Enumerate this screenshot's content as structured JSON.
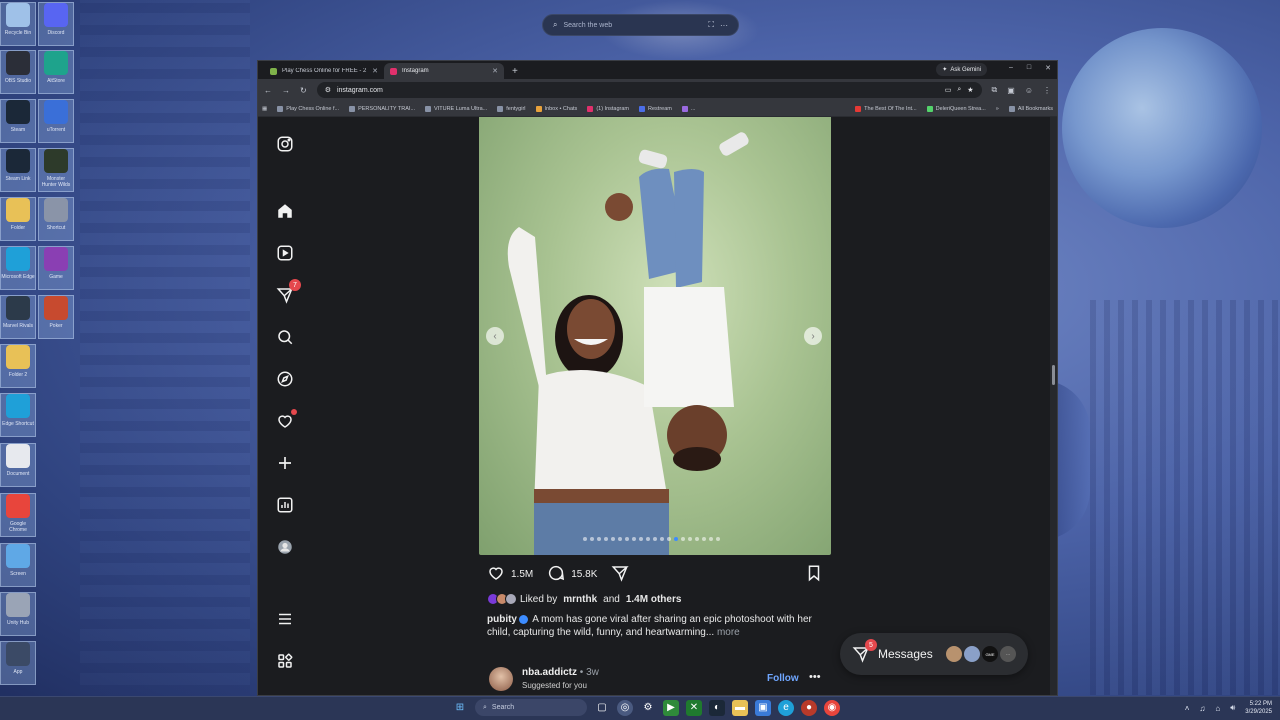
{
  "desktop": {
    "search_placeholder": "Search the web",
    "icons": [
      {
        "label": "Recycle Bin",
        "color": "#9fc1e8"
      },
      {
        "label": "Discord",
        "color": "#5865f2"
      },
      {
        "label": "OBS Studio",
        "color": "#2b2e38"
      },
      {
        "label": "AltStore",
        "color": "#1ea38c"
      },
      {
        "label": "Steam",
        "color": "#1b2838"
      },
      {
        "label": "uTorrent",
        "color": "#3a6fd8"
      },
      {
        "label": "Steam Link",
        "color": "#1b2838"
      },
      {
        "label": "Monster Hunter Wilds",
        "color": "#2d3a2a"
      },
      {
        "label": "Folder",
        "color": "#e8c157"
      },
      {
        "label": "Shortcut",
        "color": "#8a94a8"
      },
      {
        "label": "Microsoft Edge",
        "color": "#1fa0d8"
      },
      {
        "label": "Game",
        "color": "#8a3fb3"
      },
      {
        "label": "Marvel Rivals",
        "color": "#2c3a4a"
      },
      {
        "label": "Poker",
        "color": "#c74a2f"
      },
      {
        "label": "Folder 2",
        "color": "#e8c157"
      },
      {
        "label": "Edge Shortcut",
        "color": "#1fa0d8"
      },
      {
        "label": "Document",
        "color": "#e7e9ee"
      },
      {
        "label": "Google Chrome",
        "color": "#e8453c"
      },
      {
        "label": "Screen",
        "color": "#5fa8e6"
      },
      {
        "label": "Unity Hub",
        "color": "#9aa4b6"
      },
      {
        "label": "App",
        "color": "#3b4a66"
      }
    ]
  },
  "browser": {
    "tabs": [
      {
        "title": "Play Chess Online for FREE - 2 ...",
        "favicon_color": "#7fb24a"
      },
      {
        "title": "Instagram",
        "favicon_color": "#e1306c"
      }
    ],
    "ask_gemini": "Ask Gemini",
    "url": "instagram.com",
    "bookmarks": [
      "Play Chess Online f...",
      "PERSONALITY TRAI...",
      "VITURE Luma Ultra...",
      "fentygirl",
      "Inbox • Chats",
      "(1) Instagram",
      "Restream",
      "...",
      "The Best Of The Int...",
      "DeleriQueen Strea..."
    ],
    "all_bookmarks": "All Bookmarks"
  },
  "instagram": {
    "notifications_badge": "7",
    "post": {
      "likes_count": "1.5M",
      "comments_count": "15.8K",
      "liked_by_prefix": "Liked by",
      "liked_by_user": "mrnthk",
      "liked_by_and": "and",
      "liked_by_others": "1.4M others",
      "author": "pubity",
      "caption": "A mom has gone viral after sharing an epic photoshoot with her child, capturing the wild, funny, and heartwarming...",
      "more": "more",
      "carousel_dots": 20,
      "carousel_active": 13
    },
    "suggested": {
      "username": "nba.addictz",
      "time": "3w",
      "subtitle": "Suggested for you",
      "follow": "Follow"
    },
    "messages": {
      "label": "Messages",
      "badge": "5"
    }
  },
  "taskbar": {
    "search_label": "Search",
    "time": "5:22 PM",
    "date": "3/29/2025"
  }
}
